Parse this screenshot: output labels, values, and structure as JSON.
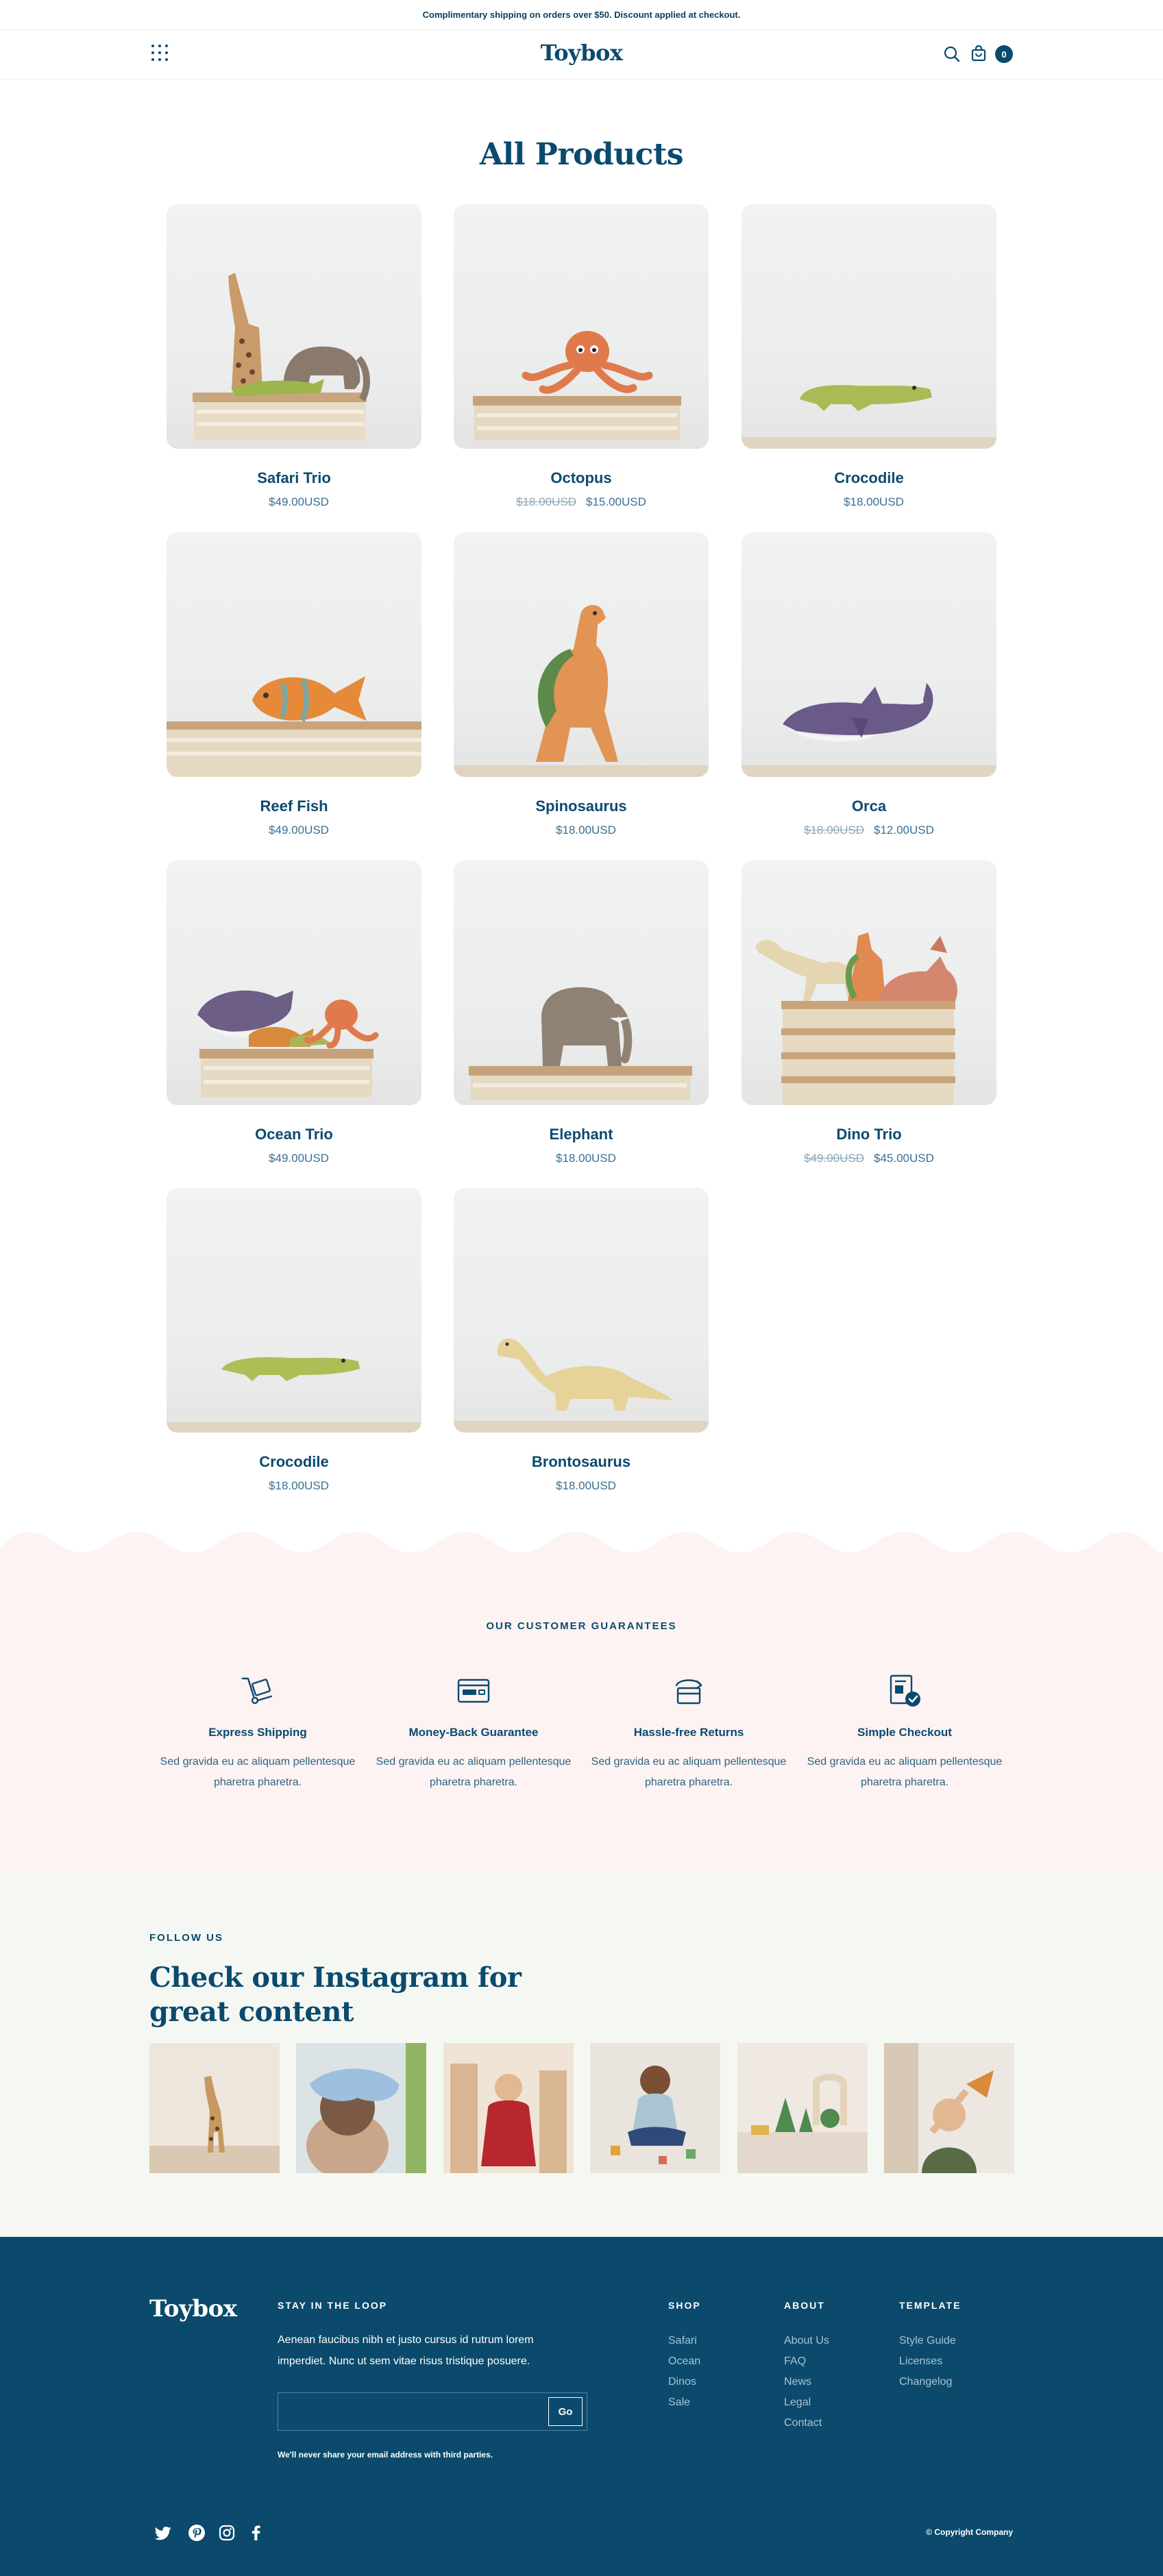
{
  "announcement": "Complimentary shipping on orders over $50. Discount applied at checkout.",
  "header": {
    "logo": "Toybox",
    "cart_count": "0"
  },
  "page_title": "All Products",
  "products": [
    {
      "name": "Safari Trio",
      "price": "$49.00USD",
      "old_price": ""
    },
    {
      "name": "Octopus",
      "price": "$15.00USD",
      "old_price": "$18.00USD"
    },
    {
      "name": "Crocodile",
      "price": "$18.00USD",
      "old_price": ""
    },
    {
      "name": "Reef Fish",
      "price": "$49.00USD",
      "old_price": ""
    },
    {
      "name": "Spinosaurus",
      "price": "$18.00USD",
      "old_price": ""
    },
    {
      "name": "Orca",
      "price": "$12.00USD",
      "old_price": "$18.00USD"
    },
    {
      "name": "Ocean Trio",
      "price": "$49.00USD",
      "old_price": ""
    },
    {
      "name": "Elephant",
      "price": "$18.00USD",
      "old_price": ""
    },
    {
      "name": "Dino Trio",
      "price": "$45.00USD",
      "old_price": "$49.00USD"
    },
    {
      "name": "Crocodile",
      "price": "$18.00USD",
      "old_price": ""
    },
    {
      "name": "Brontosaurus",
      "price": "$18.00USD",
      "old_price": ""
    }
  ],
  "guarantees": {
    "heading": "OUR CUSTOMER GUARANTEES",
    "items": [
      {
        "title": "Express Shipping",
        "text": "Sed gravida eu ac aliquam pellentesque pharetra pharetra.",
        "icon": "shipping-icon"
      },
      {
        "title": "Money-Back Guarantee",
        "text": "Sed gravida eu ac aliquam pellentesque pharetra pharetra.",
        "icon": "card-icon"
      },
      {
        "title": "Hassle-free Returns",
        "text": "Sed gravida eu ac aliquam pellentesque pharetra pharetra.",
        "icon": "returns-icon"
      },
      {
        "title": "Simple Checkout",
        "text": "Sed gravida eu ac aliquam pellentesque pharetra pharetra.",
        "icon": "checkout-icon"
      }
    ]
  },
  "instagram": {
    "kicker": "FOLLOW US",
    "title": "Check our Instagram for great content"
  },
  "footer": {
    "logo": "Toybox",
    "newsletter_heading": "STAY IN THE LOOP",
    "newsletter_text": "Aenean faucibus nibh et justo cursus id rutrum lorem imperdiet. Nunc ut sem vitae risus tristique posuere.",
    "email_placeholder": "",
    "go_label": "Go",
    "note": "We'll never share your email address with third parties.",
    "columns": [
      {
        "heading": "SHOP",
        "links": [
          "Safari",
          "Ocean",
          "Dinos",
          "Sale"
        ]
      },
      {
        "heading": "ABOUT",
        "links": [
          "About Us",
          "FAQ",
          "News",
          "Legal",
          "Contact"
        ]
      },
      {
        "heading": "TEMPLATE",
        "links": [
          "Style Guide",
          "Licenses",
          "Changelog"
        ]
      }
    ],
    "social": [
      "twitter-icon",
      "pinterest-icon",
      "instagram-icon",
      "facebook-icon"
    ],
    "copyright": "© Copyright Company"
  },
  "colors": {
    "brand": "#0b4a6f",
    "guarantee_bg": "#fdf3f2",
    "instagram_bg": "#f5f8f2",
    "footer_bg": "#0b4a6c"
  }
}
